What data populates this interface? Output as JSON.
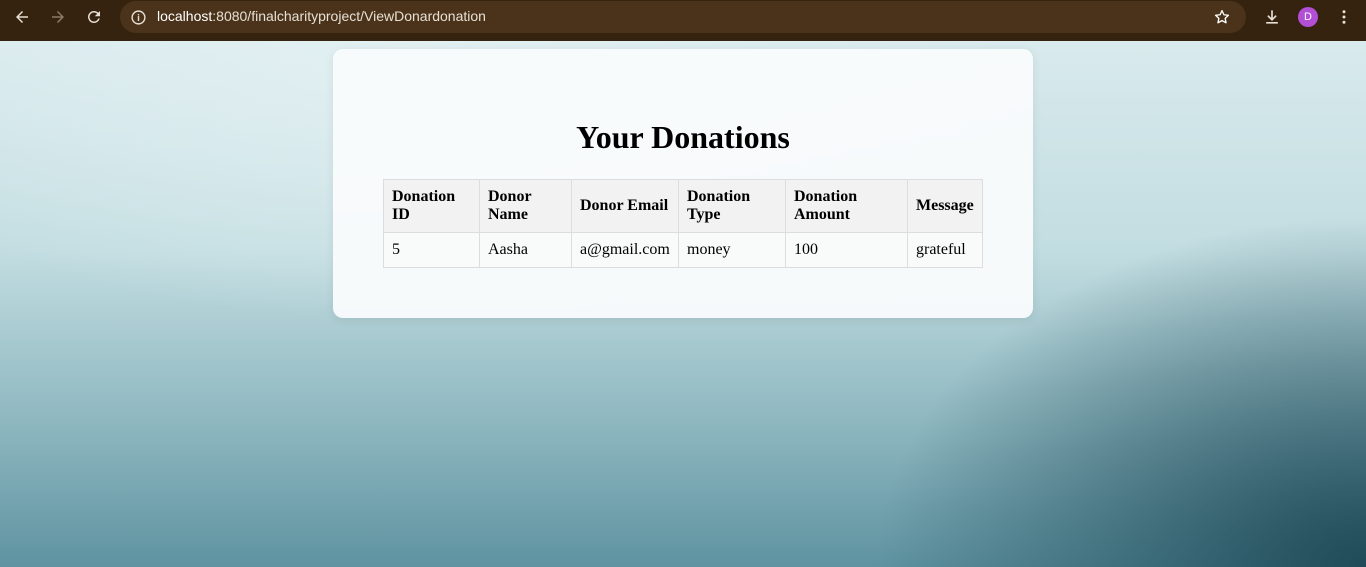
{
  "browser": {
    "url_host": "localhost",
    "url_rest": ":8080/finalcharityproject/ViewDonardonation",
    "profile_initial": "D",
    "icons": [
      "back-icon",
      "forward-icon",
      "reload-icon",
      "info-icon",
      "star-icon",
      "download-icon",
      "menu-icon"
    ]
  },
  "page": {
    "title": "Your Donations",
    "table": {
      "headers": {
        "id": [
          "Donation",
          "ID"
        ],
        "name": [
          "Donor",
          "Name"
        ],
        "email": "Donor Email",
        "type": [
          "Donation",
          "Type"
        ],
        "amount": [
          "Donation",
          "Amount"
        ],
        "message": "Message"
      },
      "rows": [
        {
          "id": "5",
          "name": "Aasha",
          "email": "a@gmail.com",
          "type": "money",
          "amount": "100",
          "message": "grateful"
        }
      ]
    }
  },
  "colors": {
    "chrome_bg": "#35230f",
    "omnibox_bg": "#4a331a",
    "avatar_bg": "#b24fd6"
  }
}
